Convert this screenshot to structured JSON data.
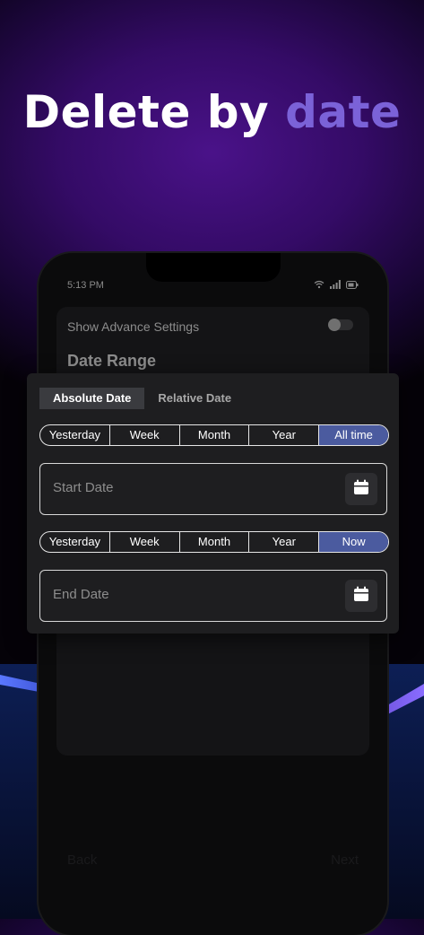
{
  "headline": {
    "prefix": "Delete by ",
    "accent": "date"
  },
  "status_bar": {
    "time": "5:13 PM",
    "icons": [
      "wifi-icon",
      "signal-icon",
      "battery-icon"
    ]
  },
  "settings": {
    "advance_label": "Show Advance Settings",
    "advance_enabled": false,
    "date_range_title": "Date Range"
  },
  "tabs": [
    {
      "label": "Absolute Date",
      "active": true
    },
    {
      "label": "Relative Date",
      "active": false
    }
  ],
  "start_presets": [
    {
      "label": "Yesterday",
      "active": false
    },
    {
      "label": "Week",
      "active": false
    },
    {
      "label": "Month",
      "active": false
    },
    {
      "label": "Year",
      "active": false
    },
    {
      "label": "All time",
      "active": true
    }
  ],
  "start_field": {
    "placeholder": "Start Date",
    "icon": "calendar-icon"
  },
  "end_presets": [
    {
      "label": "Yesterday",
      "active": false
    },
    {
      "label": "Week",
      "active": false
    },
    {
      "label": "Month",
      "active": false
    },
    {
      "label": "Year",
      "active": false
    },
    {
      "label": "Now",
      "active": true
    }
  ],
  "end_field": {
    "placeholder": "End Date",
    "icon": "calendar-icon"
  },
  "footer": {
    "back_label": "Back",
    "next_label": "Next"
  },
  "colors": {
    "accent": "#7b62d8",
    "active_chip": "#4b5b9f",
    "panel": "#1e1e20"
  }
}
